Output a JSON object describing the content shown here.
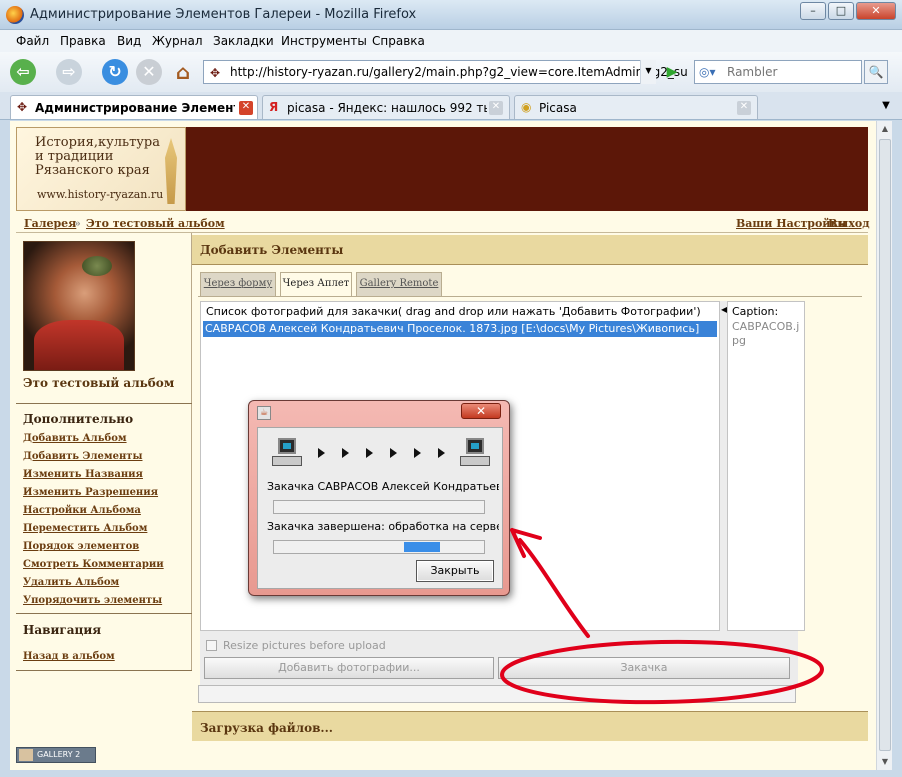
{
  "window": {
    "title": "Администрирование Элементов Галереи - Mozilla Firefox",
    "controls": {
      "minimize": "–",
      "maximize": "□",
      "close": "✕"
    }
  },
  "menu": [
    "Файл",
    "Правка",
    "Вид",
    "Журнал",
    "Закладки",
    "Инструменты",
    "Справка"
  ],
  "nav": {
    "url": "http://history-ryazan.ru/gallery2/main.php?g2_view=core.ItemAdmin&g2_su",
    "search_placeholder": "Rambler",
    "back": "⇦",
    "forward": "⇨",
    "reload": "↻",
    "stop": "✕",
    "home": "⌂",
    "go": "▶",
    "search_go": "🔍"
  },
  "tabs": [
    {
      "label": "Администрирование Элементо...",
      "favicon": "✥"
    },
    {
      "label": "picasa - Яндекс: нашлось 992 тыс...",
      "favicon": "Я"
    },
    {
      "label": "Picasa",
      "favicon": "◉"
    }
  ],
  "site": {
    "logo_line1": "История,культура",
    "logo_line2": "и традиции",
    "logo_line3": "Рязанского края",
    "logo_url": "www.history-ryazan.ru",
    "breadcrumb": [
      "Галерея",
      "Это тестовый альбом"
    ],
    "breadcrumb_sep": "»",
    "user_links": [
      "Ваши Настройки",
      "Выход"
    ]
  },
  "sidebar": {
    "album_title": "Это тестовый альбом",
    "extra_heading": "Дополнительно",
    "extra_links": [
      "Добавить Альбом",
      "Добавить Элементы",
      "Изменить Названия",
      "Изменить Разрешения",
      "Настройки Альбома",
      "Переместить Альбом",
      "Порядок элементов",
      "Смотреть Комментарии",
      "Удалить Альбом",
      "Упорядочить элементы"
    ],
    "nav_heading": "Навигация",
    "nav_links": [
      "Назад в альбом"
    ]
  },
  "main": {
    "heading": "Добавить Элементы",
    "page_tabs": [
      "Через форму",
      "Через Аплет",
      "Gallery Remote"
    ],
    "list_header": "Список фотографий для закачки( drag and drop  или нажать 'Добавить Фотографии')",
    "file_row": "САВРАСОВ Алексей Кондратьевич Проселок. 1873.jpg [E:\\docs\\My Pictures\\Живопись]",
    "caption_label": "Caption:",
    "caption_value": "САВРАСОВ.jpg",
    "resize_label": "Resize pictures before upload",
    "add_button": "Добавить фотографии...",
    "upload_button": "Закачка",
    "upload_section": "Загрузка файлов..."
  },
  "dialog": {
    "icon": "☕",
    "close": "✕",
    "line1": "Закачка САВРАСОВ Алексей Кондратьеви...",
    "line2": "Закачка завершена: обработка на сервере...",
    "progress1": 0,
    "progress2": 0.17,
    "ok_button": "Закрыть"
  },
  "footer": {
    "badge": "GALLERY 2"
  },
  "colors": {
    "banner": "#5c1708",
    "section": "#e9d9a0",
    "selection": "#3a83d8",
    "annotation": "#e0001a"
  }
}
